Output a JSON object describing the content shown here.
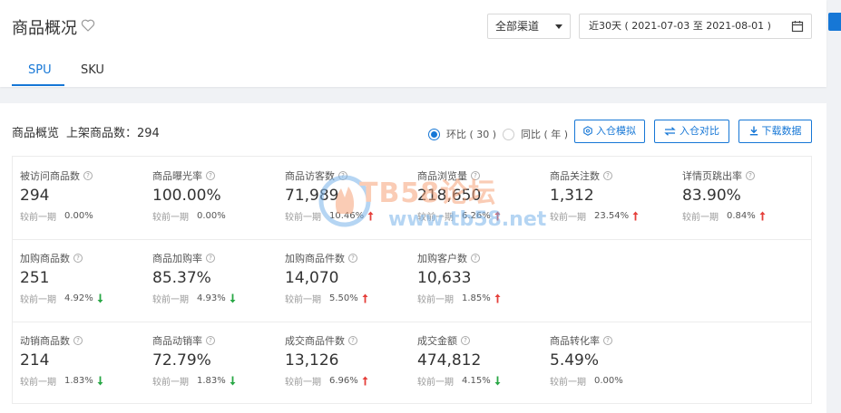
{
  "header": {
    "title": "商品概况",
    "channel": "全部渠道",
    "date_range": "近30天 ( 2021-07-03 至 2021-08-01 )",
    "tabs": [
      {
        "label": "SPU",
        "active": true
      },
      {
        "label": "SKU",
        "active": false
      }
    ]
  },
  "overview": {
    "title": "商品概览",
    "listed_label": "上架商品数：294",
    "radio": [
      {
        "label": "环比 ( 30 )",
        "checked": true
      },
      {
        "label": "同比 ( 年 )",
        "checked": false
      }
    ],
    "buttons": {
      "simulate": "入仓模拟",
      "compare": "入仓对比",
      "download": "下载数据"
    },
    "compare_prefix": "较前一期",
    "rows": [
      [
        {
          "label": "被访问商品数",
          "value": "294",
          "pct": "0.00%",
          "trend": "none"
        },
        {
          "label": "商品曝光率",
          "value": "100.00%",
          "pct": "0.00%",
          "trend": "none"
        },
        {
          "label": "商品访客数",
          "value": "71,989",
          "pct": "10.46%",
          "trend": "up"
        },
        {
          "label": "商品浏览量",
          "value": "218,650",
          "pct": "6.26%",
          "trend": "up"
        },
        {
          "label": "商品关注数",
          "value": "1,312",
          "pct": "23.54%",
          "trend": "up"
        },
        {
          "label": "详情页跳出率",
          "value": "83.90%",
          "pct": "0.84%",
          "trend": "up"
        }
      ],
      [
        {
          "label": "加购商品数",
          "value": "251",
          "pct": "4.92%",
          "trend": "down"
        },
        {
          "label": "商品加购率",
          "value": "85.37%",
          "pct": "4.93%",
          "trend": "down"
        },
        {
          "label": "加购商品件数",
          "value": "14,070",
          "pct": "5.50%",
          "trend": "up"
        },
        {
          "label": "加购客户数",
          "value": "10,633",
          "pct": "1.85%",
          "trend": "up"
        }
      ],
      [
        {
          "label": "动销商品数",
          "value": "214",
          "pct": "1.83%",
          "trend": "down"
        },
        {
          "label": "商品动销率",
          "value": "72.79%",
          "pct": "1.83%",
          "trend": "down"
        },
        {
          "label": "成交商品件数",
          "value": "13,126",
          "pct": "6.96%",
          "trend": "up"
        },
        {
          "label": "成交金额",
          "value": "474,812",
          "pct": "4.15%",
          "trend": "down"
        },
        {
          "label": "商品转化率",
          "value": "5.49%",
          "pct": "0.00%",
          "trend": "none"
        }
      ]
    ]
  },
  "watermark": {
    "line1": "TB58论坛",
    "line2": "www.tb58.net"
  },
  "colors": {
    "accent": "#1677d6",
    "up": "#e5403b",
    "down": "#28a745"
  },
  "icons": {
    "favorite": "heart-icon",
    "calendar": "calendar-icon",
    "dropdown": "caret-down-icon"
  }
}
